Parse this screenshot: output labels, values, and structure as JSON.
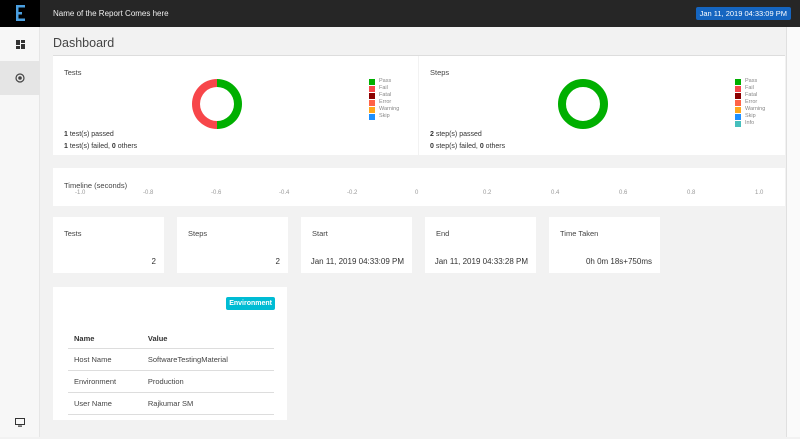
{
  "header": {
    "title": "Name of the Report Comes here",
    "date": "Jan 11, 2019 04:33:09 PM"
  },
  "sidebar": {
    "items": [
      {
        "icon": "dashboard-icon"
      },
      {
        "icon": "bug-icon"
      }
    ],
    "bottom_icon": "monitor-icon"
  },
  "page_title": "Dashboard",
  "colors": {
    "pass": "#00af00",
    "fail": "#f7464a",
    "fatal": "#8b0000",
    "error": "#ff6347",
    "warning": "#ffa81c",
    "skip": "#1e90ff",
    "info": "#46bfbd"
  },
  "tests_chart": {
    "title": "Tests",
    "legend": [
      "Pass",
      "Fail",
      "Fatal",
      "Error",
      "Warning",
      "Skip"
    ],
    "values": {
      "pass": 1,
      "fail": 1
    },
    "summary1": {
      "count": "1",
      "text": " test(s) passed"
    },
    "summary2": {
      "count": "1",
      "text": " test(s) failed, ",
      "others": "0",
      "others_text": " others"
    }
  },
  "steps_chart": {
    "title": "Steps",
    "legend": [
      "Pass",
      "Fail",
      "Fatal",
      "Error",
      "Warning",
      "Skip",
      "Info"
    ],
    "values": {
      "pass": 2,
      "fail": 0
    },
    "summary1": {
      "count": "2",
      "text": " step(s) passed"
    },
    "summary2": {
      "count": "0",
      "text": " step(s) failed, ",
      "others": "0",
      "others_text": " others"
    }
  },
  "timeline": {
    "title": "Timeline (seconds)",
    "ticks": [
      "-1.0",
      "-0.8",
      "-0.6",
      "-0.4",
      "-0.2",
      "0",
      "0.2",
      "0.4",
      "0.6",
      "0.8",
      "1.0"
    ]
  },
  "stats": [
    {
      "label": "Tests",
      "value": "2"
    },
    {
      "label": "Steps",
      "value": "2"
    },
    {
      "label": "Start",
      "value": "Jan 11, 2019 04:33:09 PM"
    },
    {
      "label": "End",
      "value": "Jan 11, 2019 04:33:28 PM"
    },
    {
      "label": "Time Taken",
      "value": "0h 0m 18s+750ms"
    }
  ],
  "environment": {
    "button": "Environment",
    "headers": [
      "Name",
      "Value"
    ],
    "rows": [
      [
        "Host Name",
        "SoftwareTestingMaterial"
      ],
      [
        "Environment",
        "Production"
      ],
      [
        "User Name",
        "Rajkumar SM"
      ]
    ]
  }
}
